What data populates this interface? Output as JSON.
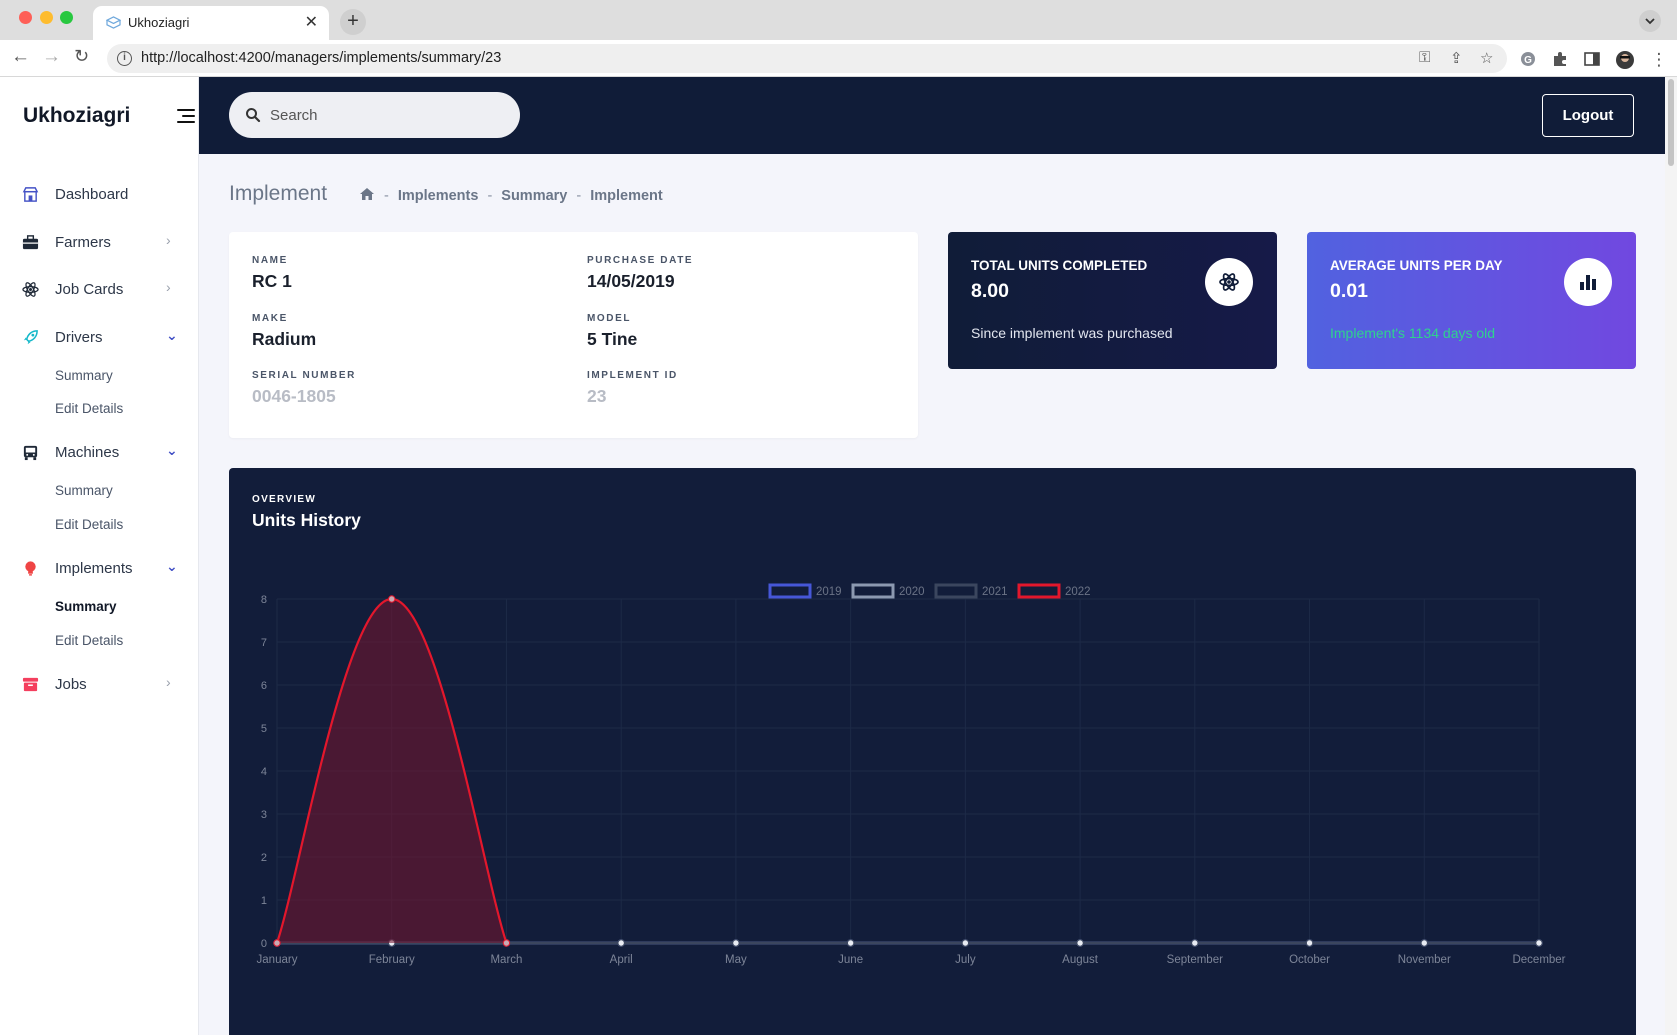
{
  "browser": {
    "tab_title": "Ukhoziagri",
    "url": "http://localhost:4200/managers/implements/summary/23"
  },
  "app": {
    "brand": "Ukhoziagri",
    "search_placeholder": "Search",
    "logout_label": "Logout"
  },
  "sidebar": {
    "items": [
      {
        "label": "Dashboard",
        "icon": "store-icon"
      },
      {
        "label": "Farmers",
        "icon": "briefcase-icon",
        "expanded": false
      },
      {
        "label": "Job Cards",
        "icon": "atom-icon",
        "expanded": false
      },
      {
        "label": "Drivers",
        "icon": "rocket-icon",
        "expanded": true,
        "sub": [
          "Summary",
          "Edit Details"
        ]
      },
      {
        "label": "Machines",
        "icon": "bus-icon",
        "expanded": true,
        "sub": [
          "Summary",
          "Edit Details"
        ]
      },
      {
        "label": "Implements",
        "icon": "bulb-icon",
        "expanded": true,
        "sub": [
          "Summary",
          "Edit Details"
        ],
        "active_sub": "Summary"
      },
      {
        "label": "Jobs",
        "icon": "archive-icon",
        "expanded": false
      }
    ]
  },
  "page": {
    "title": "Implement",
    "breadcrumb": [
      "Implements",
      "Summary",
      "Implement"
    ]
  },
  "details": {
    "name_label": "NAME",
    "name": "RC 1",
    "purchase_label": "PURCHASE DATE",
    "purchase_date": "14/05/2019",
    "make_label": "MAKE",
    "make": "Radium",
    "model_label": "MODEL",
    "model": "5 Tine",
    "serial_label": "SERIAL NUMBER",
    "serial": "0046-1805",
    "id_label": "IMPLEMENT ID",
    "implement_id": "23"
  },
  "stats": {
    "total_label": "TOTAL UNITS COMPLETED",
    "total_value": "8.00",
    "total_note": "Since implement was purchased",
    "avg_label": "AVERAGE UNITS PER DAY",
    "avg_value": "0.01",
    "avg_note": "Implement's 1134 days old"
  },
  "chart": {
    "overline": "OVERVIEW",
    "title": "Units History"
  },
  "colors": {
    "navy": "#101c38",
    "accent": "#4452c6",
    "series_2019": "#4657d8",
    "series_2020": "#8c99b0",
    "series_2021": "#3b465e",
    "series_2022": "#e3172c"
  },
  "chart_data": {
    "type": "area",
    "categories": [
      "January",
      "February",
      "March",
      "April",
      "May",
      "June",
      "July",
      "August",
      "September",
      "October",
      "November",
      "December"
    ],
    "series": [
      {
        "name": "2019",
        "values": [
          0,
          0,
          0,
          0,
          0,
          0,
          0,
          0,
          0,
          0,
          0,
          0
        ]
      },
      {
        "name": "2020",
        "values": [
          0,
          0,
          0,
          0,
          0,
          0,
          0,
          0,
          0,
          0,
          0,
          0
        ]
      },
      {
        "name": "2021",
        "values": [
          0,
          0,
          0,
          0,
          0,
          0,
          0,
          0,
          0,
          0,
          0,
          0
        ]
      },
      {
        "name": "2022",
        "values": [
          0,
          8,
          0,
          null,
          null,
          null,
          null,
          null,
          null,
          null,
          null,
          null
        ]
      }
    ],
    "y_ticks": [
      "0",
      "1",
      "2",
      "3",
      "4",
      "5",
      "6",
      "7",
      "8"
    ],
    "ylim": [
      0,
      8
    ],
    "legend": "top-center",
    "grid": true
  }
}
